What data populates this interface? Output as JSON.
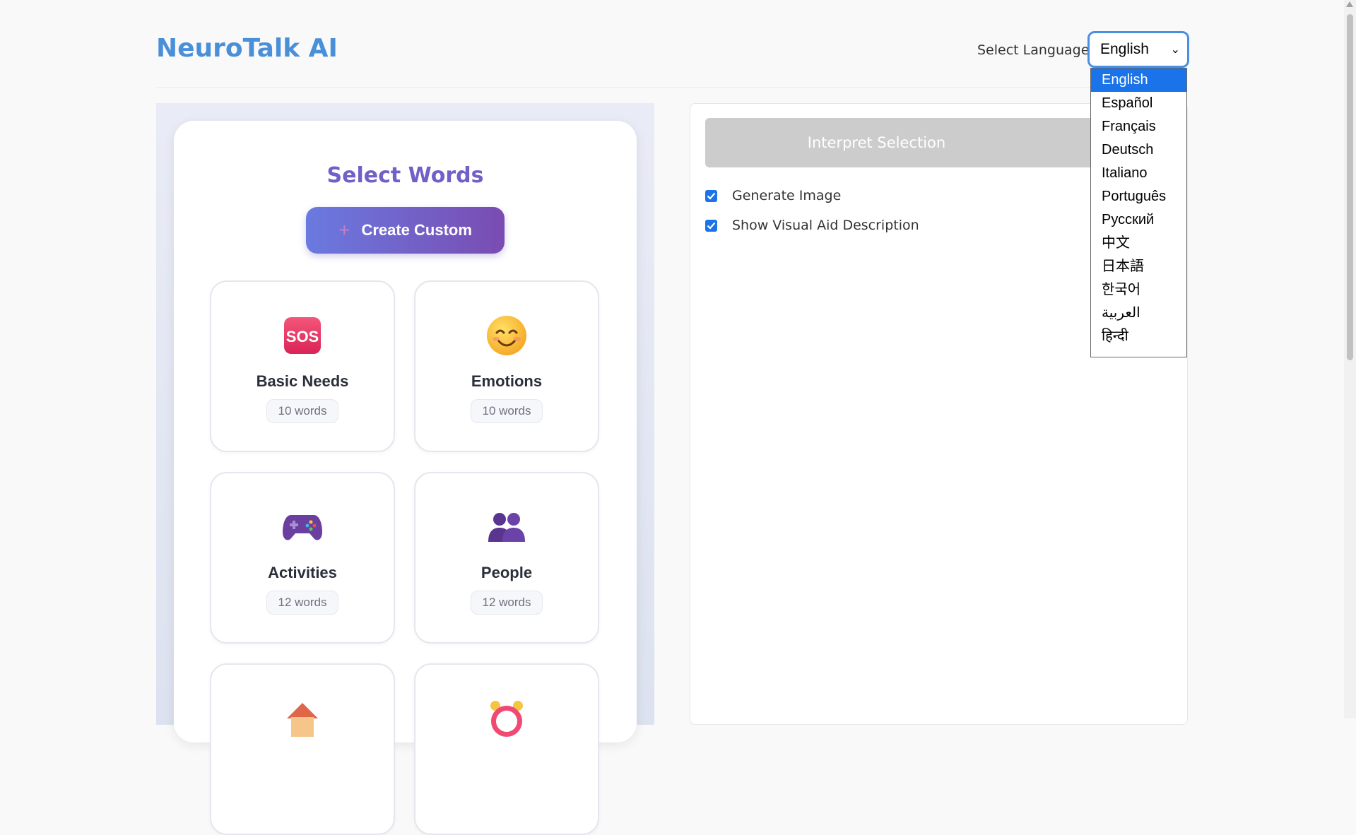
{
  "app": {
    "title": "NeuroTalk AI"
  },
  "language": {
    "label": "Select Language:",
    "selected": "English",
    "options": [
      "English",
      "Español",
      "Français",
      "Deutsch",
      "Italiano",
      "Português",
      "Русский",
      "中文",
      "日本語",
      "한국어",
      "العربية",
      "हिन्दी"
    ]
  },
  "words_panel": {
    "title": "Select Words",
    "create_custom_label": "Create Custom",
    "categories": [
      {
        "name": "Basic Needs",
        "count": "10 words",
        "icon": "sos-icon"
      },
      {
        "name": "Emotions",
        "count": "10 words",
        "icon": "smiling-face-icon"
      },
      {
        "name": "Activities",
        "count": "12 words",
        "icon": "game-controller-icon"
      },
      {
        "name": "People",
        "count": "12 words",
        "icon": "people-icon"
      },
      {
        "name": "",
        "count": "",
        "icon": "house-icon"
      },
      {
        "name": "",
        "count": "",
        "icon": "alarm-clock-icon"
      }
    ]
  },
  "right_panel": {
    "interpret_label": "Interpret Selection",
    "options": [
      {
        "label": "Generate Image",
        "checked": true
      },
      {
        "label": "Show Visual Aid Description",
        "checked": true
      }
    ]
  },
  "colors": {
    "brand": "#4a90d9",
    "accent": "#7060c8",
    "selected": "#1a73e8"
  }
}
